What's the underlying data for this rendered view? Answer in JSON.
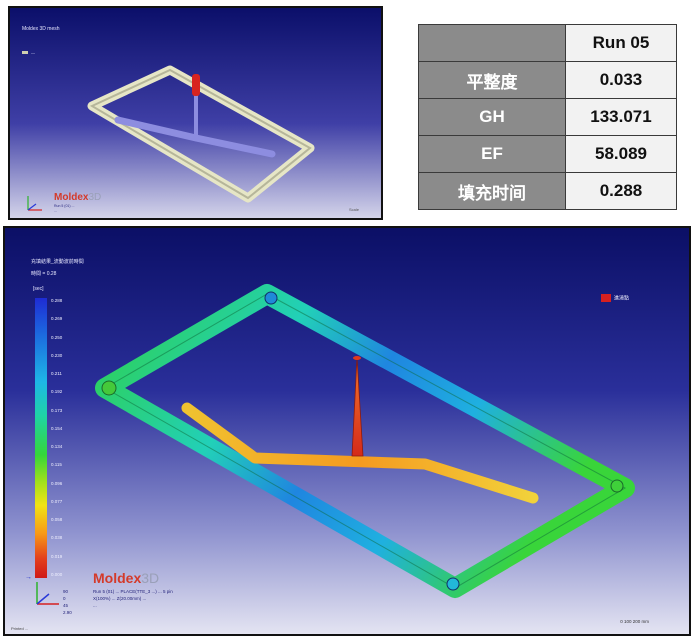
{
  "small_view": {
    "title": "Moldex 3D mesh",
    "legend_line": "—",
    "brand_main": "Moldex",
    "brand_sub": "3D",
    "info_line1": "Run 5 (01) ...",
    "info_line2": "...",
    "scale_label": "Scale"
  },
  "results_table": {
    "header": "Run 05",
    "rows": [
      {
        "label": "平整度",
        "value": "0.033"
      },
      {
        "label": "GH",
        "value": "133.071"
      },
      {
        "label": "EF",
        "value": "58.089"
      },
      {
        "label": "填充时间",
        "value": "0.288"
      }
    ]
  },
  "large_view": {
    "title": "充填結果_流動波前時間",
    "subtitle": "時間 = 0.28",
    "unit": "[sec]",
    "ticks": [
      "0.288",
      "0.269",
      "0.250",
      "0.230",
      "0.211",
      "0.192",
      "0.173",
      "0.154",
      "0.134",
      "0.115",
      "0.096",
      "0.077",
      "0.058",
      "0.038",
      "0.019",
      "0.000"
    ],
    "gate_legend": "進澆點",
    "brand_main": "Moldex",
    "brand_sub": "3D",
    "stat_col": [
      "90",
      "0",
      "45",
      "2.90"
    ],
    "info_line1": "Run 5 (01) ... PLACE(TTE_3 ...) ... 5 pin",
    "info_line2": "X(100%) ... Z(20.00mm) ...",
    "info_line3": "...",
    "footer": "Printed ...",
    "scale_label": "0   100   200 mm"
  },
  "colors": {
    "table_header_bg": "#8b8b8b",
    "table_value_bg": "#f2f2f2",
    "brand_red": "#d43a2a"
  }
}
